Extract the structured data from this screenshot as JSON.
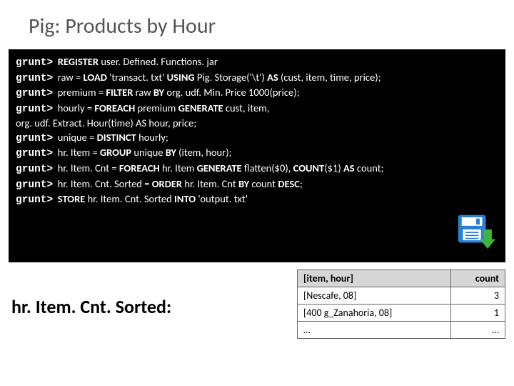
{
  "title": "Pig: Products by Hour",
  "prompt": "grunt>",
  "code": {
    "line1": "REGISTER user. Defined. Functions. jar",
    "line2": "raw = LOAD 'transact. txt' USING Pig. Storage('\\t') AS (cust, item, time, price);",
    "line3": "premium = FILTER raw BY org. udf. Min. Price 1000(price);",
    "line4": "hourly = FOREACH premium GENERATE cust, item,",
    "line4b": "org. udf. Extract. Hour(time) AS hour, price;",
    "line5": "unique = DISTINCT hourly;",
    "line6": "hr. Item = GROUP unique BY (item, hour);",
    "line7": "hr. Item. Cnt = FOREACH hr. Item GENERATE flatten($0), COUNT($1) AS count;",
    "line8": "hr. Item. Cnt. Sorted = ORDER hr. Item. Cnt BY count DESC;",
    "line9": "STORE hr. Item. Cnt. Sorted INTO 'output. txt'"
  },
  "result_var": "hr. Item. Cnt. Sorted:",
  "table": {
    "headers": {
      "c1": "[item, hour]",
      "c2": "count"
    },
    "rows": [
      {
        "c1": "[Nescafe, 08]",
        "c2": "3"
      },
      {
        "c1": "[400 g_Zanahoria, 08]",
        "c2": "1"
      },
      {
        "c1": "…",
        "c2": "…"
      }
    ]
  }
}
